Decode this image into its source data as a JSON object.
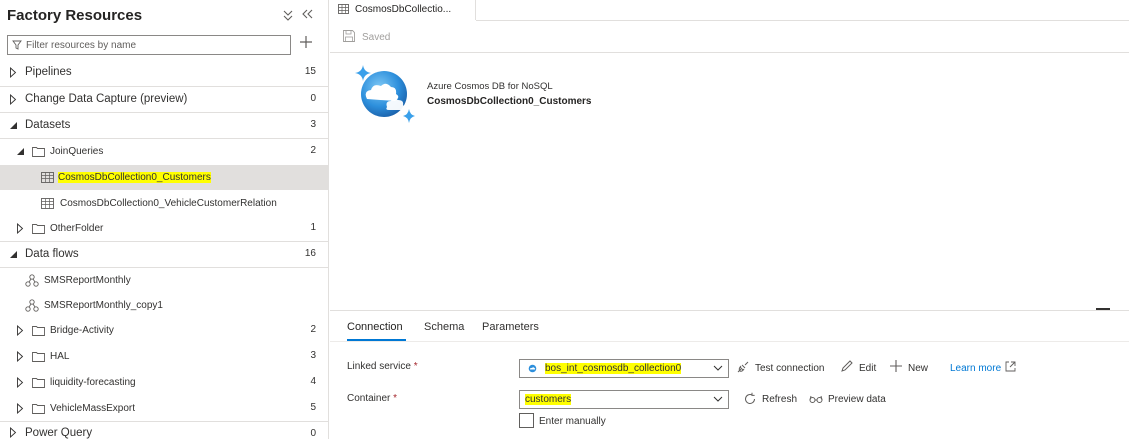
{
  "sidebar": {
    "title": "Factory Resources",
    "filter_placeholder": "Filter resources by name",
    "items": [
      {
        "label": "Pipelines",
        "count": "15"
      },
      {
        "label": "Change Data Capture (preview)",
        "count": "0"
      },
      {
        "label": "Datasets",
        "count": "3"
      },
      {
        "label": "JoinQueries",
        "count": "2"
      },
      {
        "label": "CosmosDbCollection0_Customers",
        "count": ""
      },
      {
        "label": "CosmosDbCollection0_VehicleCustomerRelation",
        "count": ""
      },
      {
        "label": "OtherFolder",
        "count": "1"
      },
      {
        "label": "Data flows",
        "count": "16"
      },
      {
        "label": "SMSReportMonthly",
        "count": ""
      },
      {
        "label": "SMSReportMonthly_copy1",
        "count": ""
      },
      {
        "label": "Bridge-Activity",
        "count": "2"
      },
      {
        "label": "HAL",
        "count": "3"
      },
      {
        "label": "liquidity-forecasting",
        "count": "4"
      },
      {
        "label": "VehicleMassExport",
        "count": "5"
      },
      {
        "label": "Power Query",
        "count": "0"
      }
    ]
  },
  "editor": {
    "tab_label": "CosmosDbCollectio...",
    "saved_label": "Saved",
    "dataset_type": "Azure Cosmos DB for NoSQL",
    "dataset_name": "CosmosDbCollection0_Customers"
  },
  "properties": {
    "tabs": [
      "Connection",
      "Schema",
      "Parameters"
    ],
    "linked_service_label": "Linked service",
    "linked_service_value": "bos_int_cosmosdb_collection0",
    "container_label": "Container",
    "container_value": "customers",
    "required_mark": "*",
    "test_connection": "Test connection",
    "edit": "Edit",
    "new": "New",
    "learn_more": "Learn more",
    "refresh": "Refresh",
    "preview_data": "Preview data",
    "enter_manually": "Enter manually"
  },
  "colors": {
    "accent": "#0078d4",
    "highlight": "#ffff00",
    "selected_row": "#e1dfdd"
  }
}
